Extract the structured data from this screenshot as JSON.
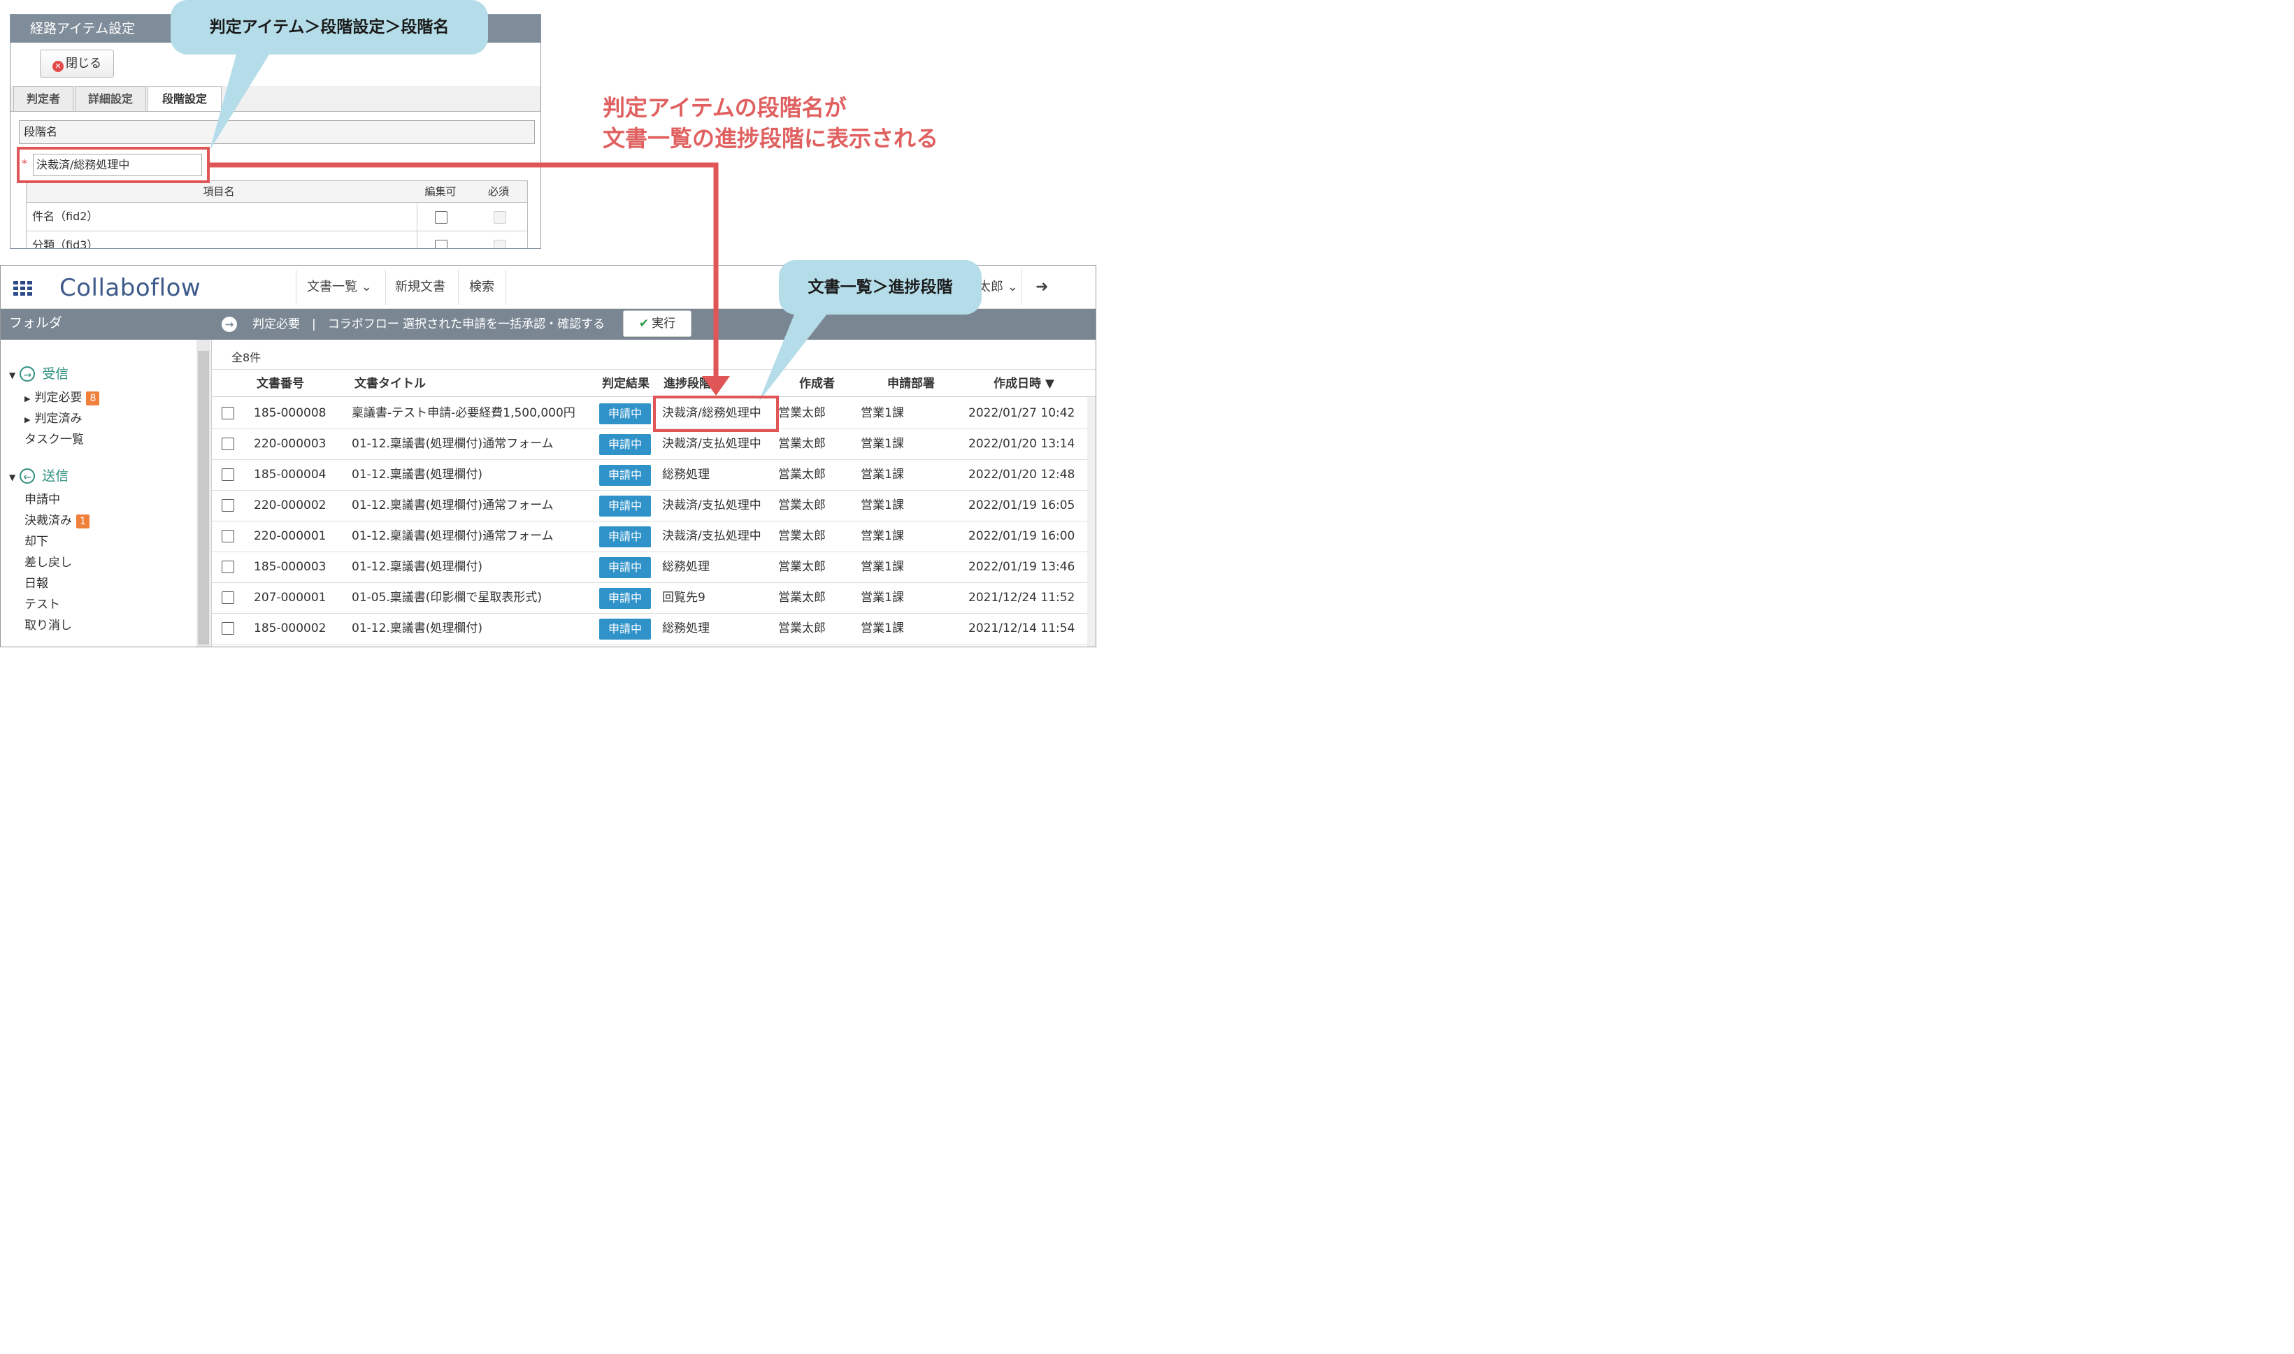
{
  "dialog": {
    "title": "経路アイテム設定",
    "close_label": "閉じる",
    "tabs": [
      "判定者",
      "詳細設定",
      "段階設定"
    ],
    "stage_name_label": "段階名",
    "stage_name_value": "決裁済/総務処理中",
    "table": {
      "headers": [
        "項目名",
        "編集可",
        "必須"
      ],
      "rows": [
        {
          "name": "件名（fid2）"
        },
        {
          "name": "分類（fid3）"
        }
      ]
    }
  },
  "callouts": {
    "top": "判定アイテム＞段階設定＞段階名",
    "bottom": "文書一覧＞進捗段階"
  },
  "annotation": {
    "line1": "判定アイテムの段階名が",
    "line2": "文書一覧の進捗段階に表示される"
  },
  "app": {
    "logo": "Collaboflow",
    "nav": [
      "文書一覧",
      "新規文書",
      "検索"
    ],
    "user_suffix": "太郎",
    "sidebar": {
      "title": "フォルダ",
      "inbox": {
        "title": "受信",
        "items": [
          {
            "label": "判定必要",
            "badge": "8"
          },
          {
            "label": "判定済み"
          },
          {
            "label": "タスク一覧"
          }
        ]
      },
      "sent": {
        "title": "送信",
        "items": [
          {
            "label": "申請中"
          },
          {
            "label": "決裁済み",
            "badge": "1"
          },
          {
            "label": "却下"
          },
          {
            "label": "差し戻し"
          },
          {
            "label": "日報"
          },
          {
            "label": "テスト"
          },
          {
            "label": "取り消し"
          }
        ]
      }
    },
    "action_bar": {
      "text": "判定必要　|　コラボフロー 選択された申請を一括承認・確認する",
      "exec_label": "実行"
    },
    "count": "全8件",
    "columns": [
      "文書番号",
      "文書タイトル",
      "判定結果",
      "進捗段階",
      "作成者",
      "申請部署",
      "作成日時 ▼"
    ],
    "rows": [
      {
        "id": "185-000008",
        "title": "稟議書-テスト申請-必要経費1,500,000円",
        "status": "申請中",
        "stage": "決裁済/総務処理中",
        "author": "営業太郎",
        "dept": "営業1課",
        "date": "2022/01/27 10:42"
      },
      {
        "id": "220-000003",
        "title": "01-12.稟議書(処理欄付)通常フォーム",
        "status": "申請中",
        "stage": "決裁済/支払処理中",
        "author": "営業太郎",
        "dept": "営業1課",
        "date": "2022/01/20 13:14"
      },
      {
        "id": "185-000004",
        "title": "01-12.稟議書(処理欄付)",
        "status": "申請中",
        "stage": "総務処理",
        "author": "営業太郎",
        "dept": "営業1課",
        "date": "2022/01/20 12:48"
      },
      {
        "id": "220-000002",
        "title": "01-12.稟議書(処理欄付)通常フォーム",
        "status": "申請中",
        "stage": "決裁済/支払処理中",
        "author": "営業太郎",
        "dept": "営業1課",
        "date": "2022/01/19 16:05"
      },
      {
        "id": "220-000001",
        "title": "01-12.稟議書(処理欄付)通常フォーム",
        "status": "申請中",
        "stage": "決裁済/支払処理中",
        "author": "営業太郎",
        "dept": "営業1課",
        "date": "2022/01/19 16:00"
      },
      {
        "id": "185-000003",
        "title": "01-12.稟議書(処理欄付)",
        "status": "申請中",
        "stage": "総務処理",
        "author": "営業太郎",
        "dept": "営業1課",
        "date": "2022/01/19 13:46"
      },
      {
        "id": "207-000001",
        "title": "01-05.稟議書(印影欄で星取表形式)",
        "status": "申請中",
        "stage": "回覧先9",
        "author": "営業太郎",
        "dept": "営業1課",
        "date": "2021/12/24 11:52"
      },
      {
        "id": "185-000002",
        "title": "01-12.稟議書(処理欄付)",
        "status": "申請中",
        "stage": "総務処理",
        "author": "営業太郎",
        "dept": "営業1課",
        "date": "2021/12/14 11:54"
      }
    ]
  },
  "colors": {
    "highlight": "#e05555",
    "callout": "#b5dde9",
    "status_badge": "#2f93c9",
    "header_bar": "#7a8793"
  }
}
